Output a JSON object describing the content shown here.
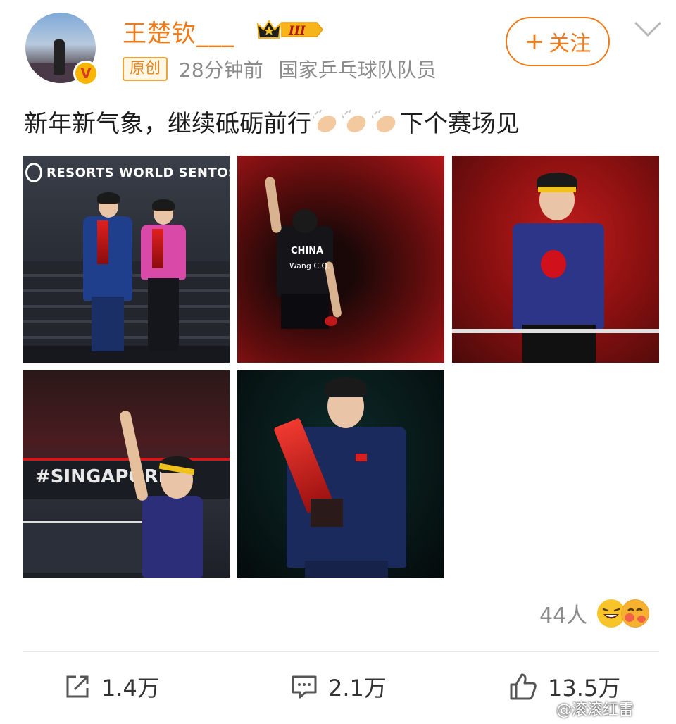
{
  "header": {
    "username": "王楚钦___",
    "level_badge": "III",
    "original_tag": "原创",
    "time": "28分钟前",
    "role": "国家乒乓球队队员",
    "follow_label": "关注",
    "follow_plus": "+"
  },
  "post": {
    "text_before": "新年新气象，继续砥砺前行",
    "text_after": "下个赛场见",
    "emoji": "clapping-hands"
  },
  "photos": {
    "p1_banner": "RESORTS WORLD SENTOSA",
    "p2_jersey": "CHINA",
    "p2_name": "Wang C.Q.",
    "p4_sign": "#SINGAPORE"
  },
  "reactions": {
    "count": "44人"
  },
  "actions": {
    "share": "1.4万",
    "comment": "2.1万",
    "like": "13.5万"
  },
  "watermark": "@滚滚红雷",
  "colors": {
    "accent": "#f07a18",
    "muted": "#8b8b8b"
  }
}
